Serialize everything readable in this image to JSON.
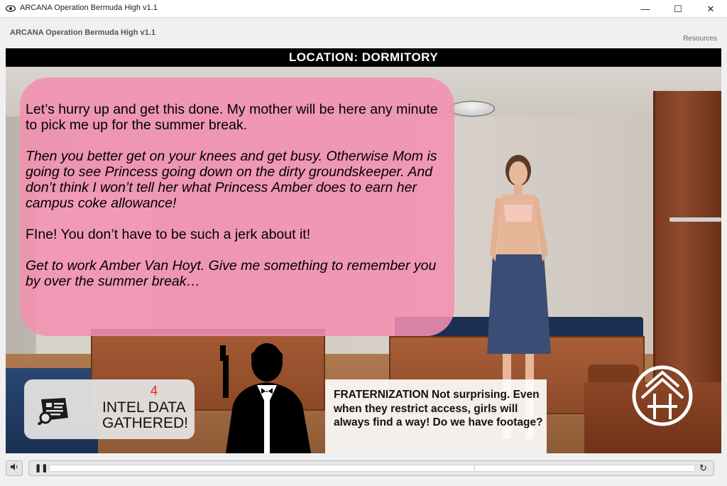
{
  "window": {
    "title": "ARCANA Operation Bermuda High v1.1",
    "minimize_glyph": "—",
    "maximize_glyph": "☐",
    "close_glyph": "✕"
  },
  "header": {
    "app_title": "ARCANA Operation Bermuda High v1.1",
    "resources_label": "Resources"
  },
  "stage": {
    "location_label": "LOCATION: DORMITORY",
    "dialogue": [
      "Let’s hurry up and get this done.  My mother will be here any minute to pick me up for the summer break.",
      "Then you better get on your knees and get busy.  Otherwise Mom is going to see Princess going down on the dirty groundskeeper.  And don’t think I won’t tell her what Princess Amber does to earn her campus coke allowance!",
      "FIne!  You don’t have to be such a jerk about it!",
      "Get to work Amber Van Hoyt. Give me something to remember you by over the summer break…"
    ],
    "intel": {
      "count": "4",
      "label_line1": "INTEL DATA",
      "label_line2": "GATHERED!",
      "icon": "intel-document-search-icon"
    },
    "message": "FRATERNIZATION   Not surprising.  Even when they restrict access, girls will always find a way!  Do we have footage?",
    "logo_icon": "arcana-emblem-icon"
  },
  "controls": {
    "volume_icon": "speaker-icon",
    "pause_glyph": "❚❚",
    "replay_glyph": "↻",
    "progress_fraction": 0.66
  },
  "colors": {
    "bubble": "#f290b0",
    "intel_count": "#e52222",
    "location_bar": "#000000"
  }
}
